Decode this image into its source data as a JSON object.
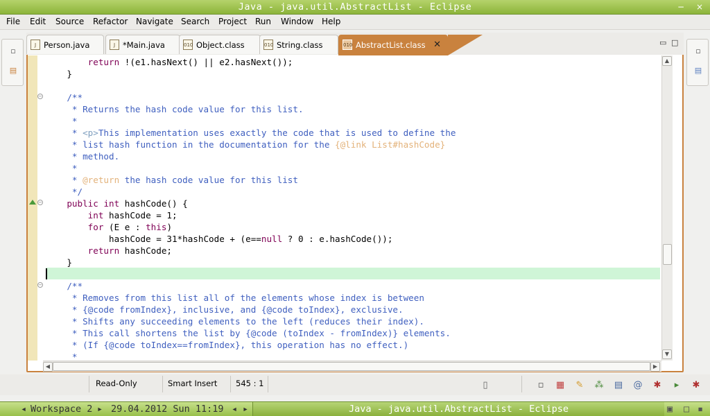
{
  "window": {
    "title": "Java - java.util.AbstractList - Eclipse"
  },
  "menu": [
    {
      "label": "File"
    },
    {
      "label": "Edit"
    },
    {
      "label": "Source"
    },
    {
      "label": "Refactor"
    },
    {
      "label": "Navigate"
    },
    {
      "label": "Search"
    },
    {
      "label": "Project"
    },
    {
      "label": "Run"
    },
    {
      "label": "Window"
    },
    {
      "label": "Help"
    }
  ],
  "tabs": [
    {
      "label": "Person.java",
      "icon": "java-file-icon"
    },
    {
      "label": "*Main.java",
      "icon": "java-file-icon"
    },
    {
      "label": "Object.class",
      "icon": "class-file-icon"
    },
    {
      "label": "String.class",
      "icon": "class-file-icon"
    },
    {
      "label": "AbstractList.class",
      "icon": "class-file-icon",
      "active": true
    }
  ],
  "tab_icon_text": "010",
  "code": [
    "        return !(e1.hasNext() || e2.hasNext());",
    "    }",
    "",
    "    /**",
    "     * Returns the hash code value for this list.",
    "     *",
    "     * <p>This implementation uses exactly the code that is used to define the",
    "     * list hash function in the documentation for the {@link List#hashCode}",
    "     * method.",
    "     *",
    "     * @return the hash code value for this list",
    "     */",
    "    public int hashCode() {",
    "        int hashCode = 1;",
    "        for (E e : this)",
    "            hashCode = 31*hashCode + (e==null ? 0 : e.hashCode());",
    "        return hashCode;",
    "    }",
    "",
    "    /**",
    "     * Removes from this list all of the elements whose index is between",
    "     * {@code fromIndex}, inclusive, and {@code toIndex}, exclusive.",
    "     * Shifts any succeeding elements to the left (reduces their index).",
    "     * This call shortens the list by {@code (toIndex - fromIndex)} elements.",
    "     * (If {@code toIndex==fromIndex}, this operation has no effect.)",
    "     *"
  ],
  "status": {
    "readonly": "Read-Only",
    "insert_mode": "Smart Insert",
    "position": "545 : 1"
  },
  "taskbar": {
    "workspace": "Workspace 2",
    "datetime": "29.04.2012 Sun 11:19",
    "title": "Java - java.util.AbstractList - Eclipse"
  },
  "colors": {
    "keyword": "#7f0055",
    "javadoc": "#3f5fbf",
    "active_tab": "#c9823e",
    "current_line": "#cff5d7"
  }
}
